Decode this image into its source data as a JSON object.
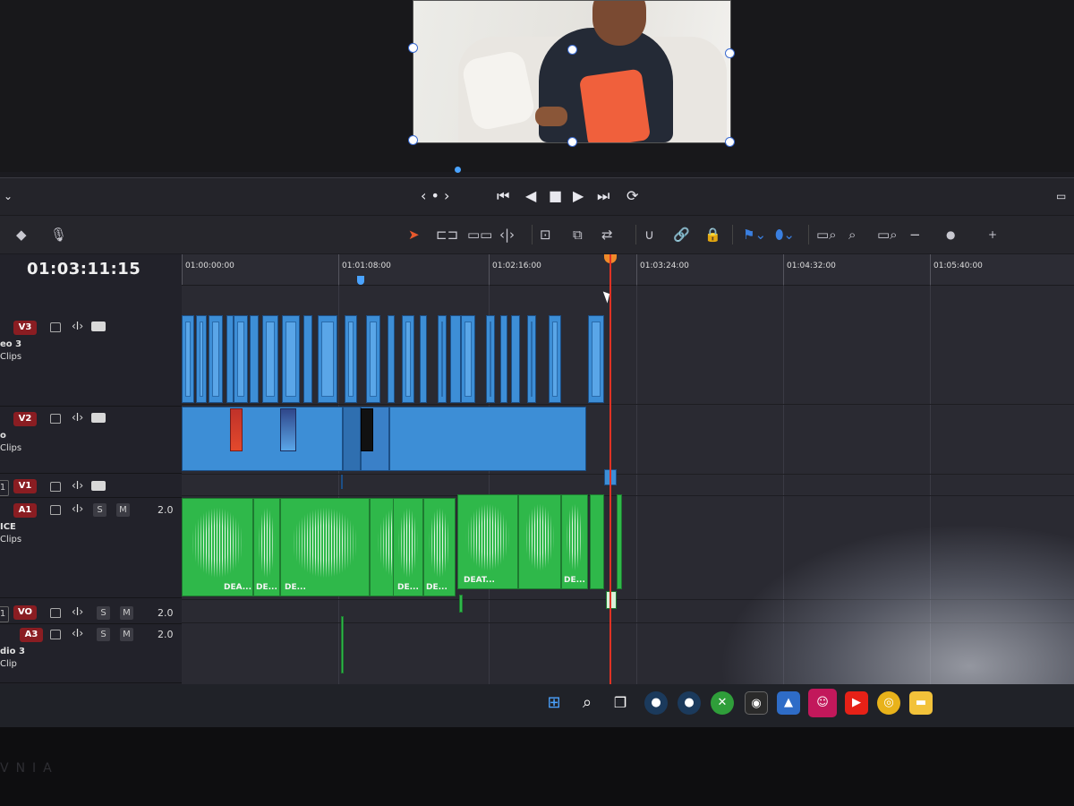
{
  "timecode": "01:03:11:15",
  "ruler": {
    "ticks": [
      "01:00:00:00",
      "01:01:08:00",
      "01:02:16:00",
      "01:03:24:00",
      "01:04:32:00",
      "01:05:40:00"
    ]
  },
  "tracks": {
    "v3": {
      "badge": "V3",
      "name": "eo 3",
      "count": "Clips"
    },
    "v2": {
      "badge": "V2",
      "name": "o",
      "count": "Clips"
    },
    "v1": {
      "badge": "V1",
      "side": "1"
    },
    "a1": {
      "badge": "A1",
      "name": "ICE",
      "count": "Clips",
      "solo": "S",
      "mute": "M",
      "channels": "2.0"
    },
    "vo": {
      "badge": "VO",
      "side": "1",
      "solo": "S",
      "mute": "M",
      "channels": "2.0"
    },
    "a3": {
      "badge": "A3",
      "name": "dio 3",
      "count": "Clip",
      "solo": "S",
      "mute": "M",
      "channels": "2.0"
    }
  },
  "audio_clips": {
    "c1": "DEA...",
    "c2": "DE...",
    "c3": "DE...",
    "c4": "DE...",
    "c5": "DE...",
    "c6": "DEAT...",
    "c7": "DE..."
  },
  "transport": {
    "jog": "‹ • ›",
    "first": "⏮",
    "prev": "◀",
    "stop": "■",
    "play": "▶",
    "last": "⏭",
    "loop": "⟳"
  },
  "colors": {
    "video_clip": "#3d8ed6",
    "audio_clip": "#2fb84a",
    "playhead": "#e03224",
    "track_badge": "#8a1d22"
  },
  "bezel_brand": "VNIA"
}
